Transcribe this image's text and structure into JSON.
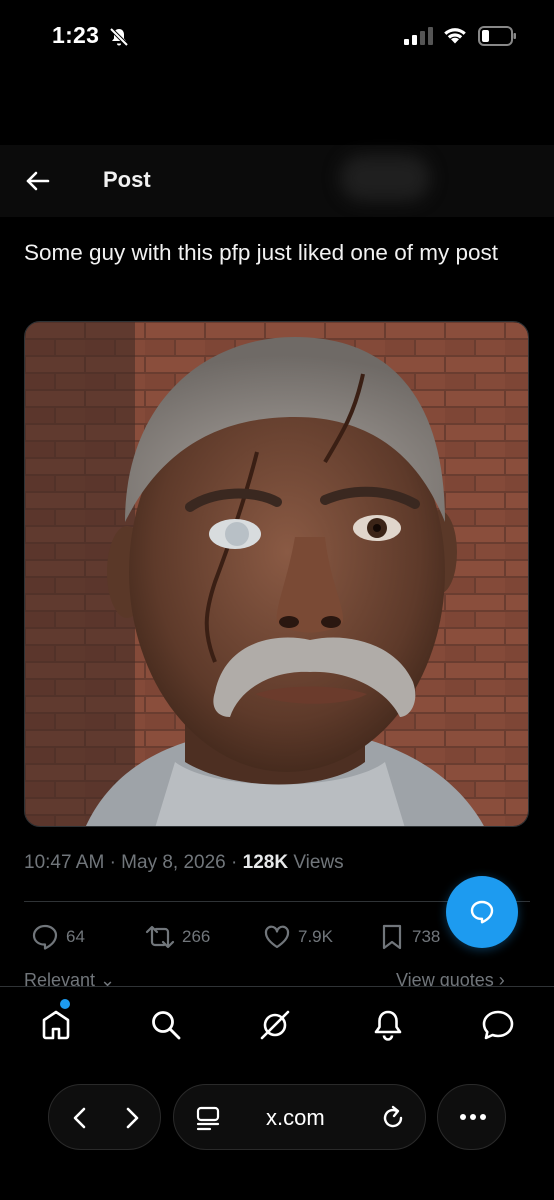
{
  "status_bar": {
    "time": "1:23"
  },
  "header": {
    "title": "Post"
  },
  "post": {
    "text": "Some guy with this pfp just liked one of my post",
    "time": "10:47 AM",
    "date": "May 8, 2026",
    "views_count": "128K",
    "views_label": "Views",
    "separator": "·"
  },
  "actions": {
    "replies": "64",
    "reposts": "266",
    "likes": "7.9K",
    "bookmarks": "738"
  },
  "sort": {
    "relevant": "Relevant",
    "view_quotes": "View quotes"
  },
  "bottom_nav": [
    "home-icon",
    "search-icon",
    "grok-icon",
    "notifications-icon",
    "messages-icon"
  ],
  "browser": {
    "url": "x.com"
  },
  "colors": {
    "accent": "#1d9bf0",
    "muted": "#71767b",
    "background": "#000000"
  }
}
